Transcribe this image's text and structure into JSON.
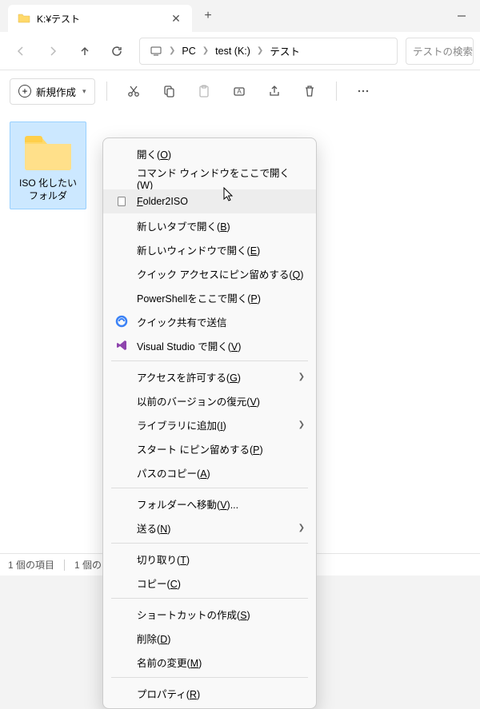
{
  "tab": {
    "title": "K:¥テスト"
  },
  "breadcrumb": [
    "PC",
    "test (K:)",
    "テスト"
  ],
  "search": {
    "placeholder": "テストの検索"
  },
  "toolbar": {
    "new_label": "新規作成"
  },
  "folder": {
    "name": "ISO 化したいフォルダ"
  },
  "status": {
    "items": "1 個の項目",
    "selected_prefix": "1 個の"
  },
  "ctx": {
    "open": "開く",
    "open_mn": "O",
    "cmd": "コマンド ウィンドウをここで開く",
    "cmd_mn": "W",
    "folder2iso": "older2ISO",
    "folder2iso_mn": "F",
    "newtab": "新しいタブで開く",
    "newtab_mn": "B",
    "newwin": "新しいウィンドウで開く",
    "newwin_mn": "E",
    "pinquick": "クイック アクセスにピン留めする",
    "pinquick_mn": "Q",
    "powershell": "PowerShellをここで開く",
    "powershell_mn": "P",
    "quickshare": "クイック共有で送信",
    "vs": "Visual Studio で開く",
    "vs_mn": "V",
    "access": "アクセスを許可する",
    "access_mn": "G",
    "restore": "以前のバージョンの復元",
    "restore_mn": "V",
    "library": "ライブラリに追加",
    "library_mn": "I",
    "pinstart": "スタート にピン留めする",
    "pinstart_mn": "P",
    "copypath": "パスのコピー",
    "copypath_mn": "A",
    "moveto": "フォルダーへ移動",
    "moveto_mn": "V",
    "moveto_suffix": "...",
    "sendto": "送る",
    "sendto_mn": "N",
    "cut": "切り取り",
    "cut_mn": "T",
    "copy": "コピー",
    "copy_mn": "C",
    "shortcut": "ショートカットの作成",
    "shortcut_mn": "S",
    "delete": "削除",
    "delete_mn": "D",
    "rename": "名前の変更",
    "rename_mn": "M",
    "properties": "プロパティ",
    "properties_mn": "R"
  }
}
